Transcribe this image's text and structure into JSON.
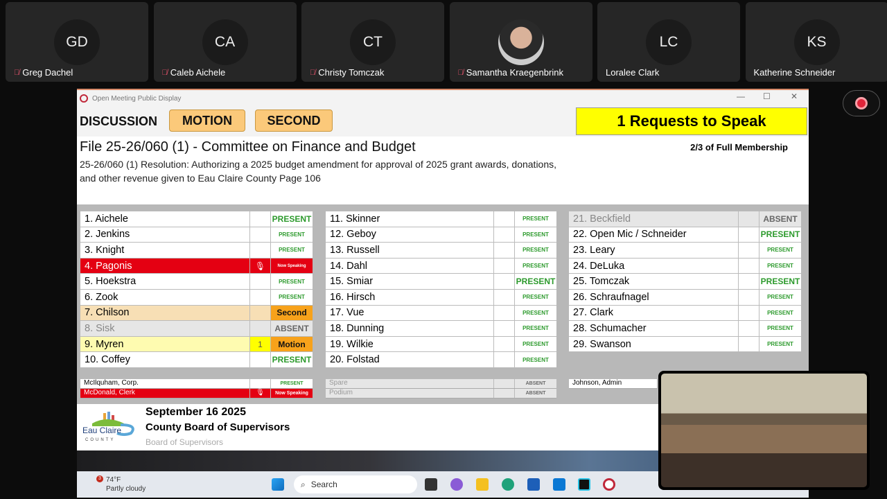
{
  "participants": [
    {
      "initials": "GD",
      "name": "Greg Dachel",
      "muted": true
    },
    {
      "initials": "CA",
      "name": "Caleb Aichele",
      "muted": true
    },
    {
      "initials": "CT",
      "name": "Christy Tomczak",
      "muted": true
    },
    {
      "initials": "",
      "name": "Samantha Kraegenbrink",
      "muted": true,
      "photo": true
    },
    {
      "initials": "LC",
      "name": "Loralee Clark",
      "muted": false
    },
    {
      "initials": "KS",
      "name": "Katherine Schneider",
      "muted": false
    }
  ],
  "window": {
    "title": "Open Meeting Public Display"
  },
  "header": {
    "discussion": "DISCUSSION",
    "motion": "MOTION",
    "second": "SECOND",
    "requests": "1 Requests to Speak"
  },
  "item": {
    "title": "File 25-26/060 (1) - Committee on Finance and Budget",
    "description": "25-26/060 (1) Resolution: Authorizing a 2025 budget amendment for approval of 2025 grant awards, donations, and other revenue given to Eau Claire County Page 106",
    "membership": "2/3 of Full Membership"
  },
  "columns": [
    [
      {
        "name": "1. Aichele",
        "status": "PRESENT",
        "big": true
      },
      {
        "name": "2. Jenkins",
        "status": "PRESENT"
      },
      {
        "name": "3. Knight",
        "status": "PRESENT"
      },
      {
        "name": "4. Pagonis",
        "status": "Now Speaking",
        "state": "speak",
        "mid": "🎙"
      },
      {
        "name": "5. Hoekstra",
        "status": "PRESENT"
      },
      {
        "name": "6. Zook",
        "status": "PRESENT"
      },
      {
        "name": "7. Chilson",
        "status": "Second",
        "state": "second"
      },
      {
        "name": "8. Sisk",
        "status": "ABSENT",
        "state": "absent"
      },
      {
        "name": "9. Myren",
        "status": "Motion",
        "state": "motion",
        "mid": "1"
      },
      {
        "name": "10. Coffey",
        "status": "PRESENT",
        "big": true
      }
    ],
    [
      {
        "name": "11. Skinner",
        "status": "PRESENT"
      },
      {
        "name": "12. Geboy",
        "status": "PRESENT"
      },
      {
        "name": "13. Russell",
        "status": "PRESENT"
      },
      {
        "name": "14. Dahl",
        "status": "PRESENT"
      },
      {
        "name": "15. Smiar",
        "status": "PRESENT",
        "big": true
      },
      {
        "name": "16. Hirsch",
        "status": "PRESENT"
      },
      {
        "name": "17. Vue",
        "status": "PRESENT"
      },
      {
        "name": "18. Dunning",
        "status": "PRESENT"
      },
      {
        "name": "19. Wilkie",
        "status": "PRESENT"
      },
      {
        "name": "20. Folstad",
        "status": "PRESENT"
      }
    ],
    [
      {
        "name": "21. Beckfield",
        "status": "ABSENT",
        "state": "absent"
      },
      {
        "name": "22. Open Mic / Schneider",
        "status": "PRESENT",
        "big": true
      },
      {
        "name": "23. Leary",
        "status": "PRESENT"
      },
      {
        "name": "24. DeLuka",
        "status": "PRESENT"
      },
      {
        "name": "25. Tomczak",
        "status": "PRESENT",
        "big": true
      },
      {
        "name": "26. Schraufnagel",
        "status": "PRESENT"
      },
      {
        "name": "27. Clark",
        "status": "PRESENT"
      },
      {
        "name": "28. Schumacher",
        "status": "PRESENT"
      },
      {
        "name": "29. Swanson",
        "status": "PRESENT"
      }
    ]
  ],
  "staff": [
    [
      {
        "name": "McIlquham, Corp.",
        "status": "PRESENT"
      },
      {
        "name": "McDonald, Clerk",
        "status": "Now Speaking",
        "state": "speak",
        "mid": "🎙"
      }
    ],
    [
      {
        "name": "Spare",
        "status": "ABSENT",
        "state": "abs"
      },
      {
        "name": "Podium",
        "status": "ABSENT",
        "state": "abs"
      }
    ],
    [
      {
        "name": "Johnson, Admin",
        "status": ""
      }
    ]
  ],
  "footer": {
    "date": "September 16 2025",
    "body": "County Board of Supervisors",
    "sub": "Board of Supervisors",
    "logo_text": "Eau Claire COUNTY"
  },
  "taskbar": {
    "temp": "74°F",
    "weather": "Partly cloudy",
    "badge": "3",
    "search": "Search"
  }
}
